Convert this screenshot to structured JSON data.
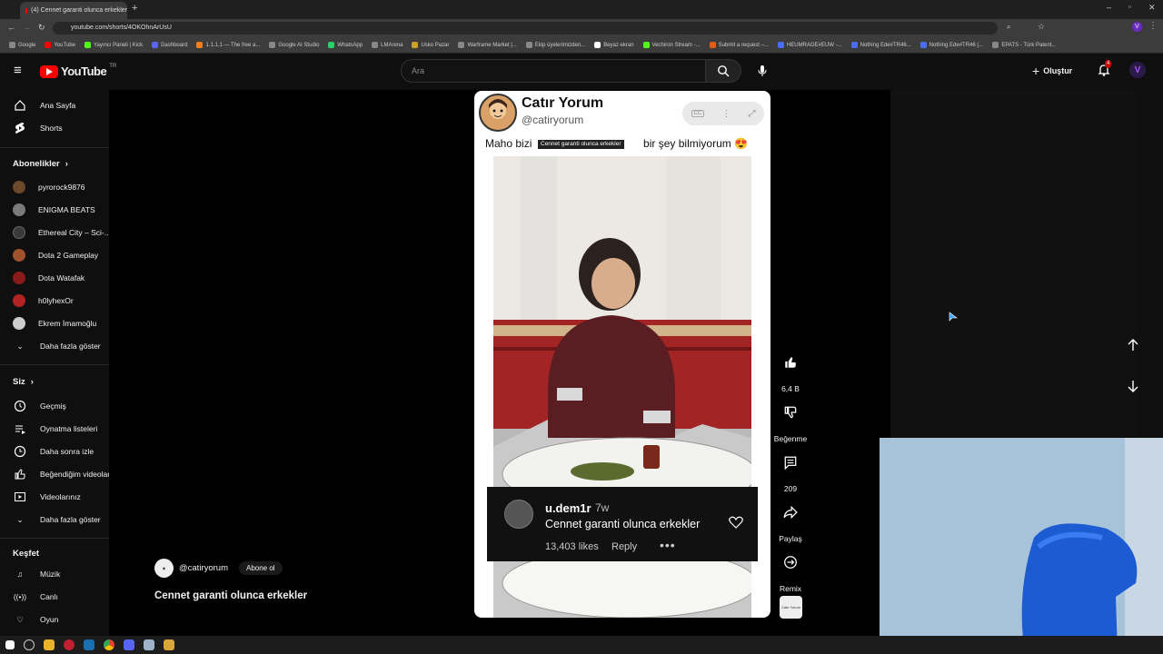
{
  "browser": {
    "tab_title": "(4) Cennet garanti olunca erkekler",
    "url": "youtube.com/shorts/4OKOhnArUsU",
    "bookmarks": [
      "Google",
      "YouTube",
      "Yayıncı Paneli | Kick",
      "Dashboard",
      "1.1.1.1 — The free a...",
      "Google AI Studio",
      "WhatsApp",
      "LMArena",
      "Usko Pazar",
      "Warframe Market |...",
      "Ekip üyelerimizden...",
      "Beyaz ekran",
      "Vechiron Stream -...",
      "Submit a request –...",
      "HEUMRAGE#EUW -...",
      "Nothing Ede#TR46...",
      "Nothing Ede#TR46 (...",
      "EPATS - Türk Patent..."
    ]
  },
  "header": {
    "logo_text": "YouTube",
    "logo_region": "TR",
    "search_placeholder": "Ara",
    "create_label": "Oluştur",
    "notif_count": "4",
    "avatar_letter": "V"
  },
  "sidebar": {
    "main": [
      {
        "label": "Ana Sayfa",
        "icon": "home-icon"
      },
      {
        "label": "Shorts",
        "icon": "shorts-icon"
      }
    ],
    "subs_heading": "Abonelikler",
    "subs": [
      {
        "label": "pyrorock9876",
        "color": "#6b4a2b"
      },
      {
        "label": "ENIGMA BEATS",
        "color": "#7a7a7a"
      },
      {
        "label": "Ethereal City – Sci-...",
        "color": "#3a3a3a"
      },
      {
        "label": "Dota 2 Gameplay",
        "color": "#a0522d"
      },
      {
        "label": "Dota Watafak",
        "color": "#8b1a1a"
      },
      {
        "label": "h0lyhexOr",
        "color": "#b22222"
      },
      {
        "label": "Ekrem İmamoğlu",
        "color": "#cccccc"
      }
    ],
    "subs_more": "Daha fazla göster",
    "you_heading": "Siz",
    "you": [
      {
        "label": "Geçmiş",
        "icon": "history-icon"
      },
      {
        "label": "Oynatma listeleri",
        "icon": "playlists-icon"
      },
      {
        "label": "Daha sonra izle",
        "icon": "watch-later-icon"
      },
      {
        "label": "Beğendiğim videolar",
        "icon": "liked-icon"
      },
      {
        "label": "Videolarınız",
        "icon": "your-videos-icon"
      }
    ],
    "you_more": "Daha fazla göster",
    "explore_heading": "Keşfet",
    "explore": [
      {
        "label": "Müzik",
        "icon": "music-icon"
      },
      {
        "label": "Canlı",
        "icon": "live-icon"
      },
      {
        "label": "Oyun",
        "icon": "gaming-icon"
      }
    ]
  },
  "short": {
    "channel_name": "Catır Yorum",
    "channel_handle": "@catiryorum",
    "caption_left": "Maho bizi",
    "caption_right": "bir şey bilmiyorum 😍",
    "caption_overlay": "Cennet garanti olunca erkekler",
    "comment": {
      "user": "u.dem1r",
      "time": "7w",
      "text": "Cennet garanti olunca erkekler",
      "likes": "13,403 likes",
      "reply": "Reply",
      "more": "•••"
    }
  },
  "actions": {
    "like_count": "6,4 B",
    "dislike_label": "Beğenme",
    "comment_count": "209",
    "share_label": "Paylaş",
    "remix_label": "Remix",
    "channel_thumb": "Catır Yorum"
  },
  "below": {
    "handle": "@catiryorum",
    "subscribe": "Abone ol",
    "title": "Cennet garanti olunca erkekler"
  }
}
